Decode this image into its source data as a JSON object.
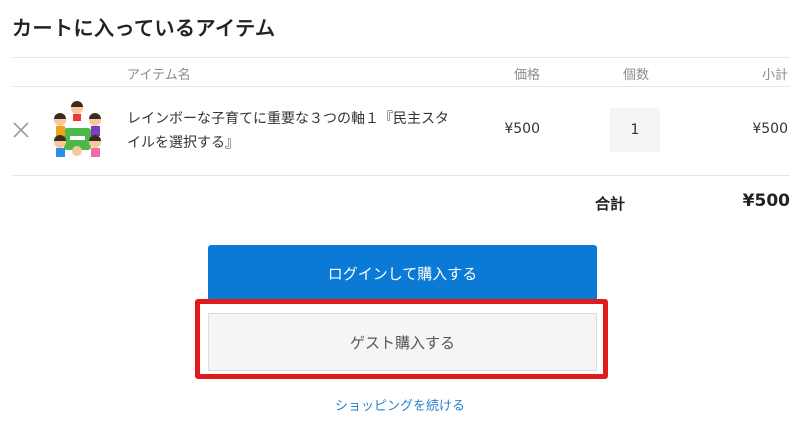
{
  "page": {
    "title": "カートに入っているアイテム"
  },
  "table": {
    "headers": {
      "name": "アイテム名",
      "price": "価格",
      "quantity": "個数",
      "subtotal": "小計"
    },
    "rows": [
      {
        "name": "レインボーな子育てに重要な３つの軸１『民主スタイルを選択する』",
        "price": "¥500",
        "quantity": "1",
        "subtotal": "¥500",
        "thumbnail_icon": "children-illustration-icon",
        "remove_icon": "close-icon"
      }
    ]
  },
  "totals": {
    "label": "合計",
    "value": "¥500"
  },
  "actions": {
    "login_purchase": "ログインして購入する",
    "guest_purchase": "ゲスト購入する",
    "continue_shopping": "ショッピングを続ける"
  },
  "colors": {
    "primary_button": "#0a7ad6",
    "highlight_border": "#e01b1b",
    "link": "#2b7fd1"
  }
}
